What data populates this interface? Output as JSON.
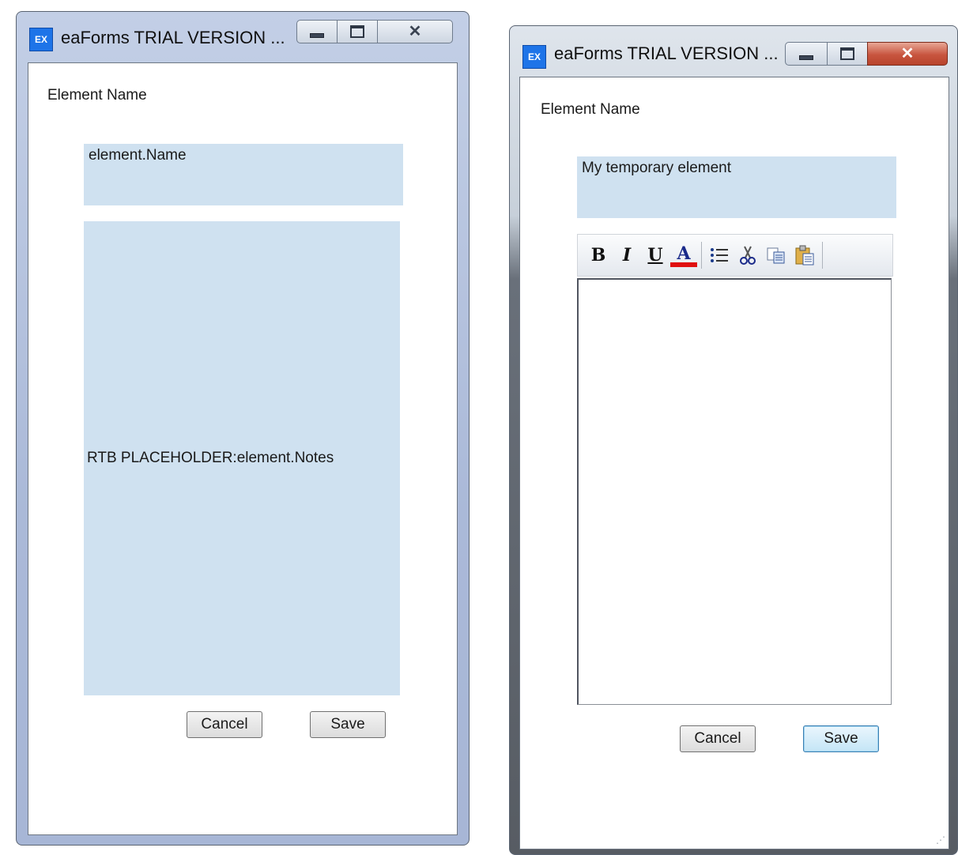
{
  "windows": [
    {
      "title": "eaForms TRIAL VERSION ...",
      "app_icon": "EX",
      "element_name_label": "Element Name",
      "name_field_value": "element.Name",
      "notes_placeholder": "RTB PLACEHOLDER:element.Notes",
      "cancel_label": "Cancel",
      "save_label": "Save"
    },
    {
      "title": "eaForms TRIAL VERSION ...",
      "app_icon": "EX",
      "element_name_label": "Element Name",
      "name_field_value": "My temporary element",
      "toolbar": {
        "bold": "B",
        "italic": "I",
        "underline": "U",
        "font_color": "A",
        "icons": [
          "bold-icon",
          "italic-icon",
          "underline-icon",
          "font-color-icon",
          "bullet-list-icon",
          "cut-icon",
          "copy-icon",
          "paste-icon"
        ]
      },
      "cancel_label": "Cancel",
      "save_label": "Save"
    }
  ],
  "colors": {
    "field_bg": "#cfe1f0",
    "app_icon_bg": "#1e74e8",
    "close_button_red": "#c8553f",
    "font_color_red": "#e01010",
    "save_focus_border": "#3c7fb1"
  }
}
